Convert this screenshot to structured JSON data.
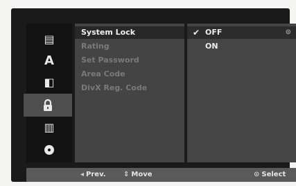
{
  "icons": [
    {
      "name": "disc-settings-icon",
      "glyph": "▤"
    },
    {
      "name": "language-icon",
      "glyph": "A"
    },
    {
      "name": "audio-icon",
      "glyph": "◧"
    },
    {
      "name": "lock-icon",
      "glyph": "🔒"
    },
    {
      "name": "film-icon",
      "glyph": "▥"
    },
    {
      "name": "disc-icon",
      "glyph": "●"
    }
  ],
  "menu": {
    "items": [
      "System Lock",
      "Rating",
      "Set Password",
      "Area Code",
      "DivX Reg. Code"
    ]
  },
  "options": {
    "items": [
      "OFF",
      "ON"
    ],
    "selected": "OFF",
    "check_glyph": "✔",
    "right_glyph": "⊙"
  },
  "footer": {
    "prev_symbol": "◂",
    "prev": "Prev.",
    "move_symbol": "⇕",
    "move": "Move",
    "select_symbol": "⊙",
    "select": "Select"
  }
}
